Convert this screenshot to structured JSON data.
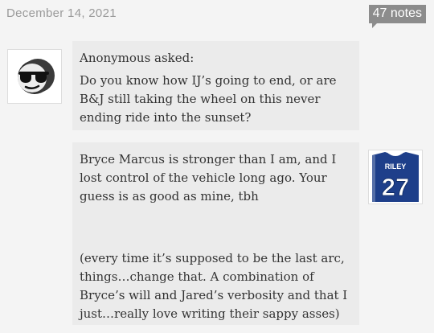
{
  "post": {
    "date": "December 14, 2021",
    "notes": "47 notes"
  },
  "question": {
    "asker": "Anonymous asked:",
    "text": "Do you know how IJ’s going to end, or are B&J still taking the wheel on this never ending ride into the sunset?",
    "avatar_icon": "sunglasses-face-icon"
  },
  "answer": {
    "paragraphs": [
      "Bryce Marcus is stronger than I am, and I lost control of the vehicle long ago. Your guess is as good as mine, tbh",
      "(every time it’s supposed to be the last arc, things…change that. A combination of Bryce’s will and Jared’s verbosity and that I just…really love writing their sappy asses)"
    ],
    "avatar_icon": "hockey-jersey-icon",
    "jersey_name": "RILEY",
    "jersey_number": "27"
  },
  "colors": {
    "background": "#f4f4f4",
    "bubble": "#ebebeb",
    "badge": "#8c8c8c",
    "jersey_blue": "#1e3f8a"
  }
}
